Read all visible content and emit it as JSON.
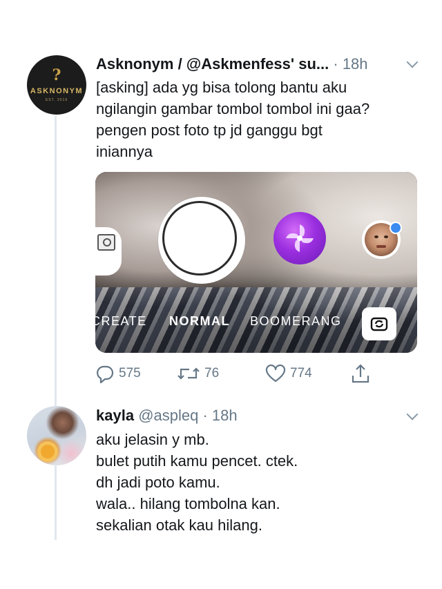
{
  "tweet1": {
    "display_name": "Asknonym / @Askmenfess' su...",
    "time": "· 18h",
    "avatar": {
      "mark": "?",
      "brand": "ASKNONYM",
      "est": "EST. 2019"
    },
    "lines": [
      "[asking] ada yg bisa tolong bantu aku",
      "ngilangin gambar tombol tombol ini gaa?",
      "pengen post foto tp jd ganggu bgt",
      "iniannya"
    ],
    "media": {
      "modes": [
        "CREATE",
        "NORMAL",
        "BOOMERANG"
      ]
    },
    "actions": {
      "replies": "575",
      "retweets": "76",
      "likes": "774"
    }
  },
  "tweet2": {
    "display_name": "kayla",
    "handle": "@aspleq",
    "time": "· 18h",
    "lines": [
      "aku jelasin y mb.",
      "bulet putih kamu pencet. ctek.",
      "dh jadi poto kamu.",
      "wala.. hilang tombolna kan.",
      "sekalian otak kau hilang."
    ]
  }
}
